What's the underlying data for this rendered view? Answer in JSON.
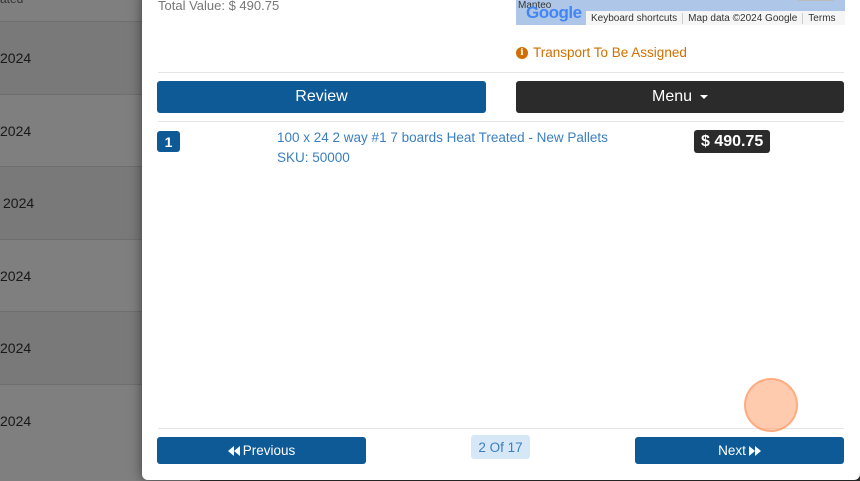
{
  "background": {
    "header_fragment": "ated",
    "rows": [
      "2024",
      "2024",
      "2024",
      "2024",
      "2024",
      "2024"
    ]
  },
  "modal": {
    "total_value": "Total Value: $ 490.75",
    "map": {
      "town": "Manteo",
      "logo": "Google",
      "shortcuts": "Keyboard shortcuts",
      "map_data": "Map data ©2024 Google",
      "terms": "Terms"
    },
    "transport_status": "Transport To Be Assigned",
    "review_label": "Review",
    "menu_label": "Menu",
    "item": {
      "index": "1",
      "title": "100 x 24 2 way #1 7 boards Heat Treated - New Pallets",
      "sku": "SKU: 50000",
      "price": "$ 490.75"
    },
    "pagination": {
      "previous_label": "Previous",
      "next_label": "Next",
      "page_indicator": "2 Of 17"
    }
  },
  "colors": {
    "primary": "#0d5a96",
    "dark": "#2b2b2b",
    "warning": "#d06e00",
    "link": "#3a7fc1"
  }
}
